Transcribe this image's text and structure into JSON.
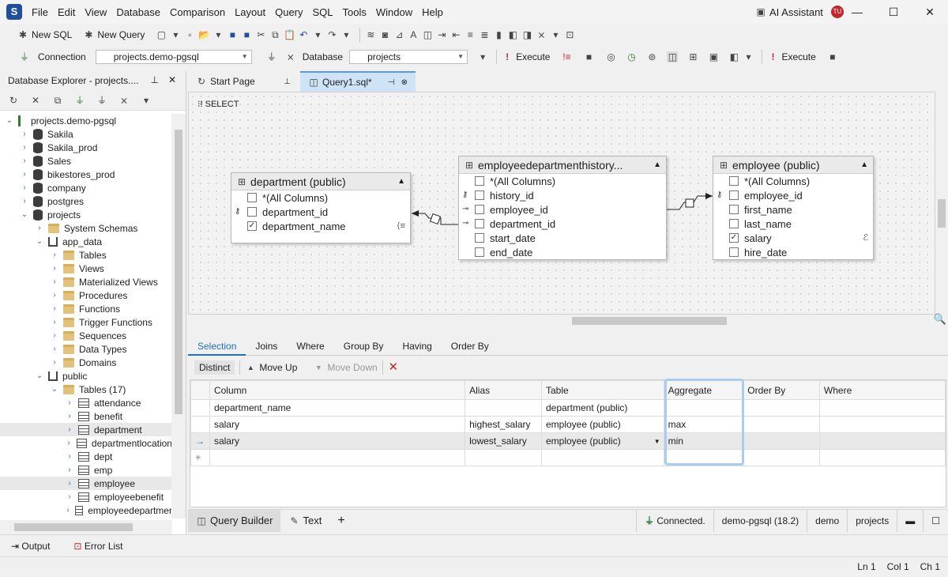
{
  "app": {
    "logo": "S",
    "menu": [
      "File",
      "Edit",
      "View",
      "Database",
      "Comparison",
      "Layout",
      "Query",
      "SQL",
      "Tools",
      "Window",
      "Help"
    ],
    "ai_assistant": "AI Assistant",
    "avatar": "TU"
  },
  "toolbar1": {
    "new_sql": "New SQL",
    "new_query": "New Query"
  },
  "toolbar2": {
    "connection_label": "Connection",
    "connection_value": "projects.demo-pgsql",
    "database_label": "Database",
    "database_value": "projects",
    "execute": "Execute",
    "execute2": "Execute"
  },
  "explorer": {
    "title": "Database Explorer - projects....",
    "tree": [
      {
        "label": "projects.demo-pgsql",
        "icon": "conn",
        "indent": 0,
        "open": true
      },
      {
        "label": "Sakila",
        "icon": "db",
        "indent": 1
      },
      {
        "label": "Sakila_prod",
        "icon": "db",
        "indent": 1
      },
      {
        "label": "Sales",
        "icon": "db",
        "indent": 1
      },
      {
        "label": "bikestores_prod",
        "icon": "db",
        "indent": 1
      },
      {
        "label": "company",
        "icon": "db",
        "indent": 1
      },
      {
        "label": "postgres",
        "icon": "db",
        "indent": 1
      },
      {
        "label": "projects",
        "icon": "db",
        "indent": 1,
        "open": true
      },
      {
        "label": "System Schemas",
        "icon": "fold",
        "indent": 2
      },
      {
        "label": "app_data",
        "icon": "schema",
        "indent": 2,
        "open": true
      },
      {
        "label": "Tables",
        "icon": "fold",
        "indent": 3
      },
      {
        "label": "Views",
        "icon": "fold",
        "indent": 3
      },
      {
        "label": "Materialized Views",
        "icon": "fold",
        "indent": 3
      },
      {
        "label": "Procedures",
        "icon": "fold",
        "indent": 3
      },
      {
        "label": "Functions",
        "icon": "fold",
        "indent": 3
      },
      {
        "label": "Trigger Functions",
        "icon": "fold",
        "indent": 3
      },
      {
        "label": "Sequences",
        "icon": "fold",
        "indent": 3
      },
      {
        "label": "Data Types",
        "icon": "fold",
        "indent": 3
      },
      {
        "label": "Domains",
        "icon": "fold",
        "indent": 3
      },
      {
        "label": "public",
        "icon": "schema",
        "indent": 2,
        "open": true
      },
      {
        "label": "Tables (17)",
        "icon": "fold",
        "indent": 3,
        "open": true
      },
      {
        "label": "attendance",
        "icon": "tbl",
        "indent": 4
      },
      {
        "label": "benefit",
        "icon": "tbl",
        "indent": 4
      },
      {
        "label": "department",
        "icon": "tbl",
        "indent": 4,
        "sel": true
      },
      {
        "label": "departmentlocation",
        "icon": "tbl",
        "indent": 4
      },
      {
        "label": "dept",
        "icon": "tbl",
        "indent": 4
      },
      {
        "label": "emp",
        "icon": "tbl",
        "indent": 4
      },
      {
        "label": "employee",
        "icon": "tbl",
        "indent": 4,
        "sel": true
      },
      {
        "label": "employeebenefit",
        "icon": "tbl",
        "indent": 4
      },
      {
        "label": "employeedepartmer",
        "icon": "tbl",
        "indent": 4
      }
    ]
  },
  "tabs": {
    "start": "Start Page",
    "query": "Query1.sql*"
  },
  "canvas": {
    "select_label": "SELECT",
    "department": {
      "title": "department (public)",
      "fields": [
        {
          "name": "*(All Columns)",
          "checked": false,
          "key": ""
        },
        {
          "name": "department_id",
          "checked": false,
          "key": "pk"
        },
        {
          "name": "department_name",
          "checked": true,
          "key": ""
        }
      ]
    },
    "history": {
      "title": "employeedepartmenthistory...",
      "fields": [
        {
          "name": "*(All Columns)",
          "checked": false,
          "key": ""
        },
        {
          "name": "history_id",
          "checked": false,
          "key": "pk"
        },
        {
          "name": "employee_id",
          "checked": false,
          "key": "fk"
        },
        {
          "name": "department_id",
          "checked": false,
          "key": "fk"
        },
        {
          "name": "start_date",
          "checked": false,
          "key": ""
        },
        {
          "name": "end_date",
          "checked": false,
          "key": ""
        }
      ]
    },
    "employee": {
      "title": "employee (public)",
      "fields": [
        {
          "name": "*(All Columns)",
          "checked": false,
          "key": ""
        },
        {
          "name": "employee_id",
          "checked": false,
          "key": "pk"
        },
        {
          "name": "first_name",
          "checked": false,
          "key": ""
        },
        {
          "name": "last_name",
          "checked": false,
          "key": ""
        },
        {
          "name": "salary",
          "checked": true,
          "key": ""
        },
        {
          "name": "hire_date",
          "checked": false,
          "key": ""
        }
      ]
    }
  },
  "qtabs": [
    "Selection",
    "Joins",
    "Where",
    "Group By",
    "Having",
    "Order By"
  ],
  "qtools": {
    "distinct": "Distinct",
    "move_up": "Move Up",
    "move_down": "Move Down"
  },
  "grid": {
    "headers": [
      "Column",
      "Alias",
      "Table",
      "Aggregate",
      "Order By",
      "Where"
    ],
    "rows": [
      [
        "department_name",
        "",
        "department (public)",
        "",
        "",
        ""
      ],
      [
        "salary",
        "highest_salary",
        "employee (public)",
        "max",
        "",
        ""
      ],
      [
        "salary",
        "lowest_salary",
        "employee (public)",
        "min",
        "",
        ""
      ]
    ]
  },
  "bottom": {
    "query_builder": "Query Builder",
    "text": "Text",
    "connected": "Connected.",
    "server": "demo-pgsql (18.2)",
    "user": "demo",
    "db": "projects"
  },
  "output": {
    "output": "Output",
    "errors": "Error List"
  },
  "statusbar": {
    "ln": "Ln 1",
    "col": "Col 1",
    "ch": "Ch 1"
  }
}
